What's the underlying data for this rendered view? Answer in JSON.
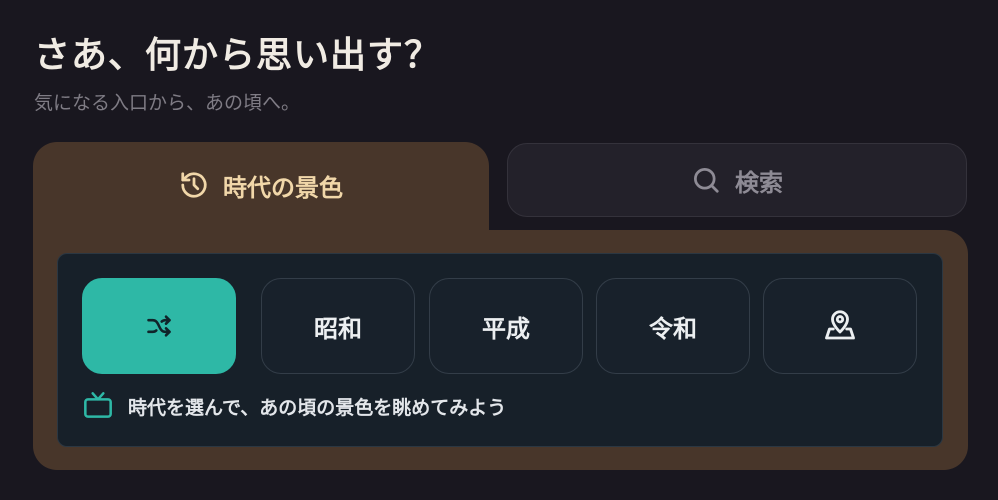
{
  "header": {
    "title": "さあ、何から思い出す？",
    "subtitle": "気になる入口から、あの頃へ。"
  },
  "tabs": [
    {
      "label": "時代の景色",
      "icon": "history-icon",
      "active": true
    },
    {
      "label": "検索",
      "icon": "search-icon",
      "active": false
    }
  ],
  "eras": {
    "shuffle_icon": "shuffle-icon",
    "showa": "昭和",
    "heisei": "平成",
    "reiwa": "令和",
    "location_icon": "map-pin-icon"
  },
  "hint": {
    "icon": "tv-icon",
    "text": "時代を選んで、あの頃の景色を眺めてみよう"
  },
  "colors": {
    "background": "#19171f",
    "panel": "#48362a",
    "accent": "#2eb8a6",
    "active_tab_text": "#f1d7a9"
  }
}
